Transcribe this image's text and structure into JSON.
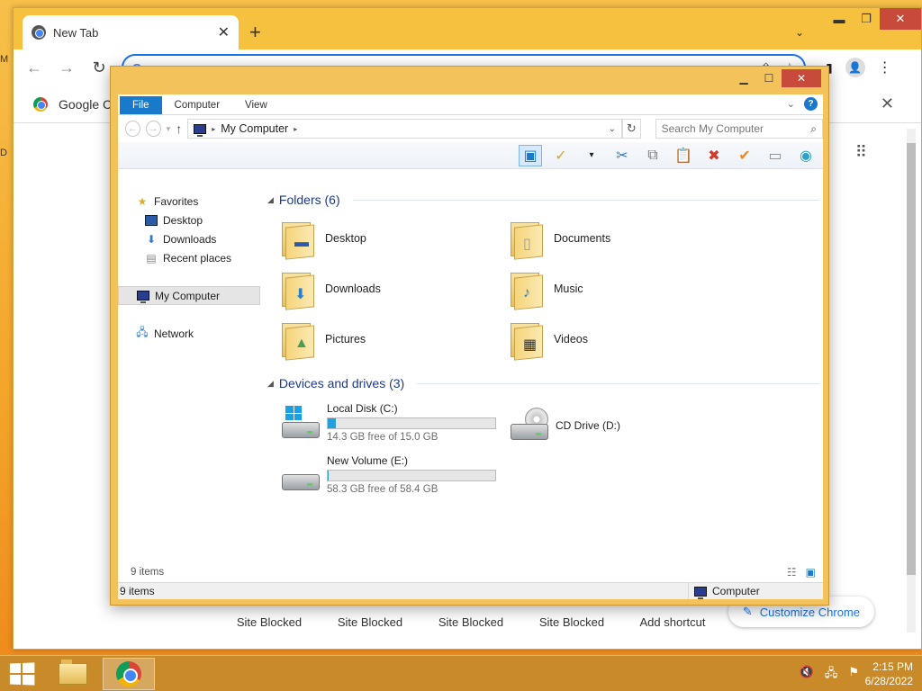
{
  "desktop": {
    "edge_letters": [
      "M",
      "D"
    ]
  },
  "chrome": {
    "tab_title": "New Tab",
    "new_tab_symbol": "+",
    "omnibox_icon": "G",
    "infobar_text": "Google C",
    "shortcuts": [
      "Site Blocked",
      "Site Blocked",
      "Site Blocked",
      "Site Blocked",
      "Add shortcut"
    ],
    "customize_label": "Customize Chrome"
  },
  "explorer": {
    "ribbon_tabs": [
      "File",
      "Computer",
      "View"
    ],
    "address": "My Computer",
    "search_placeholder": "Search My Computer",
    "nav": {
      "favorites": "Favorites",
      "desktop": "Desktop",
      "downloads": "Downloads",
      "recent": "Recent places",
      "computer": "My Computer",
      "network": "Network"
    },
    "folders_header": "Folders (6)",
    "folders": [
      "Desktop",
      "Documents",
      "Downloads",
      "Music",
      "Pictures",
      "Videos"
    ],
    "drives_header": "Devices and drives (3)",
    "drives": [
      {
        "name": "Local Disk (C:)",
        "free": "14.3 GB free of 15.0 GB",
        "used_fraction": 0.047
      },
      {
        "name": "CD Drive (D:)"
      },
      {
        "name": "New Volume (E:)",
        "free": "58.3 GB free of 58.4 GB",
        "used_fraction": 0.002
      }
    ],
    "items_count": "9 items",
    "status_left": "9 items",
    "status_right": "Computer"
  },
  "taskbar": {
    "time": "2:15 PM",
    "date": "6/28/2022"
  },
  "colors": {
    "accent": "#1979ca",
    "chrome_frame": "#f6c13f",
    "taskbar": "#c98b2a"
  }
}
